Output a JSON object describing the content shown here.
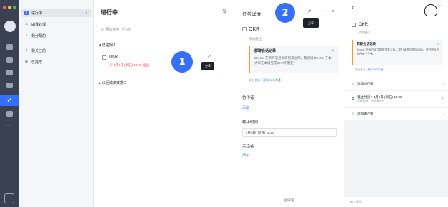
{
  "colors": {
    "accent": "#3370ff",
    "danger": "#f54a45",
    "rail": "#3a4152"
  },
  "nav": {
    "items": [
      {
        "label": "进行中",
        "count": "3",
        "icon": "list-icon"
      },
      {
        "label": "由我处理",
        "count": "",
        "icon": "user-icon"
      },
      {
        "label": "我分配的",
        "count": "",
        "icon": "assign-icon"
      },
      {
        "label": "我关注的",
        "count": "1",
        "icon": "follow-icon"
      },
      {
        "label": "已完成",
        "count": "",
        "icon": "done-icon"
      }
    ]
  },
  "list": {
    "title": "进行中",
    "add_task": "添加任务 (⌘+N)",
    "section_overdue": "已逾期 1",
    "section_later": "以后或未安排 2",
    "task": {
      "name": "OKR",
      "due": "4月9日 (周五) 18:00 截止",
      "share_tip": "分享"
    },
    "badge": "1"
  },
  "detail": {
    "title": "任务详情",
    "badge": "2",
    "share_tip": "分享",
    "task_name": "OKR",
    "add_note": "添加备注",
    "quote_title": "群聊会话记录",
    "quote_body": "Becca: 在新的双月即将到来之际，我们请 Becca: 于本大家在本周完成OKR的制定",
    "source_prefix": "来自会话：",
    "source_link": "双月OKR沟通",
    "collaborators_label": "协作者",
    "collaborators_add": "添加",
    "due_label": "截止时间",
    "due_value": "4月9日 (周五) 18:00",
    "followers_label": "关注者",
    "followers_add": "添加",
    "comment": "评论"
  },
  "mobile": {
    "task_name": "OKR",
    "add_note": "添加备注",
    "quote_title": "群聊会话记录",
    "quote_body": "Becca: 在新的双月即将到来之际，我们请各位做好OKR，并在团队内部评审一下❤。",
    "source_prefix": "来自会话：",
    "source_link": "双月OKR沟通",
    "add_collaborator": "添加协作者",
    "due_label": "截止时间：4月9日 (周五) 18:00",
    "due_sub": "提醒时间：任务截止时",
    "add_follower": "添加关注者",
    "input_placeholder": "输入评论"
  }
}
